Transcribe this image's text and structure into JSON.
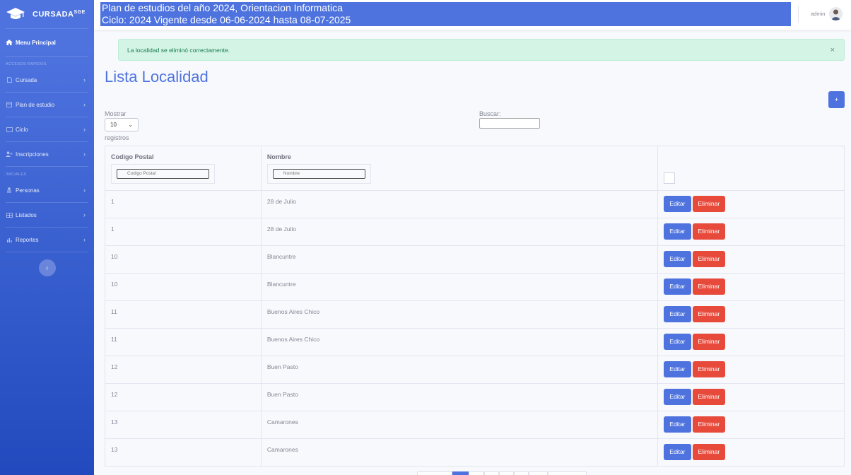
{
  "sidebar": {
    "brand": "CURSADA",
    "brand_sup": "SGE",
    "main_item": "Menu Principal",
    "heading_accesos": "ACCESOS RAPIDOS",
    "heading_iniciales": "INICIALES",
    "items": [
      {
        "label": "Cursada",
        "icon": "file-icon"
      },
      {
        "label": "Plan de estudio",
        "icon": "calendar-icon"
      },
      {
        "label": "Ciclo",
        "icon": "id-card-icon"
      },
      {
        "label": "Inscripciones",
        "icon": "user-plus-icon"
      },
      {
        "label": "Personas",
        "icon": "users-icon"
      },
      {
        "label": "Listados",
        "icon": "table-icon"
      },
      {
        "label": "Reportes",
        "icon": "chart-icon"
      }
    ]
  },
  "topbar": {
    "plan_line1": "Plan de estudios del año 2024, Orientacion Informatica",
    "plan_line2": "Ciclo: 2024 Vigente desde 06-06-2024 hasta 08-07-2025",
    "user": "admin"
  },
  "alert": {
    "message": "La localidad se eliminó correctamente.",
    "close": "×"
  },
  "page": {
    "title": "Lista Localidad",
    "add_label": "+"
  },
  "controls": {
    "show_label": "Mostrar",
    "page_length": "10",
    "records_label": "registros",
    "search_label": "Buscar:"
  },
  "table": {
    "headers": [
      "Codigo Postal",
      "Nombre"
    ],
    "filter_placeholders": [
      "Codigo Postal",
      "Nombre"
    ],
    "edit_label": "Editar",
    "delete_label": "Eliminar",
    "rows": [
      {
        "codigo": "1",
        "nombre": "28 de Julio"
      },
      {
        "codigo": "1",
        "nombre": "28 de Julio"
      },
      {
        "codigo": "10",
        "nombre": "Blancuntre"
      },
      {
        "codigo": "10",
        "nombre": "Blancuntre"
      },
      {
        "codigo": "11",
        "nombre": "Buenos Aires Chico"
      },
      {
        "codigo": "11",
        "nombre": "Buenos Aires Chico"
      },
      {
        "codigo": "12",
        "nombre": "Buen Pasto"
      },
      {
        "codigo": "12",
        "nombre": "Buen Pasto"
      },
      {
        "codigo": "13",
        "nombre": "Camarones"
      },
      {
        "codigo": "13",
        "nombre": "Camarones"
      }
    ]
  },
  "colors": {
    "primary": "#4e73df",
    "danger": "#e74a3b",
    "success_bg": "#d4f5e6"
  }
}
